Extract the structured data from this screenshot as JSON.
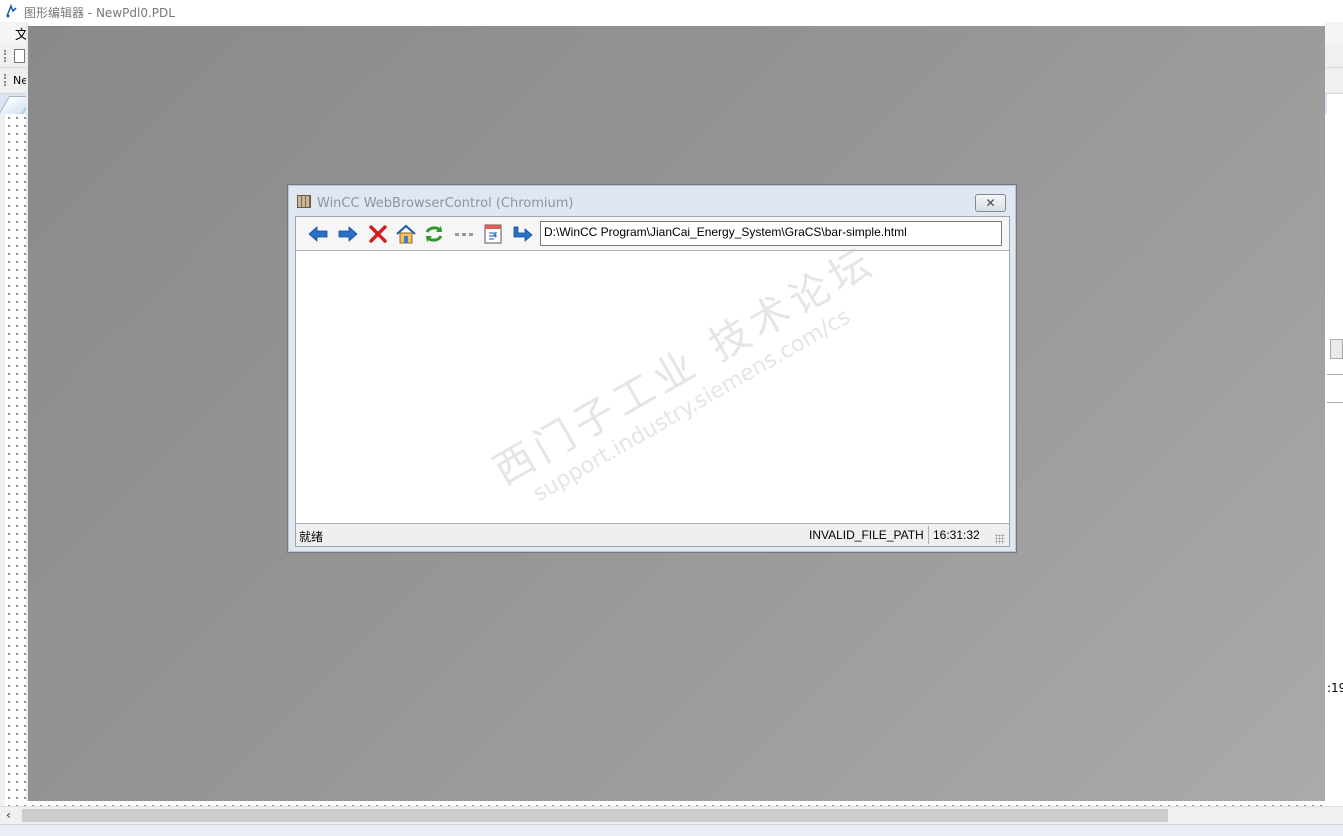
{
  "app": {
    "title": "图形编辑器 - NewPdl0.PDL",
    "menu_first": "文",
    "toolbar_label": "Ne"
  },
  "right_edge": {
    "cut_text": ":19"
  },
  "dialog": {
    "title": "WinCC WebBrowserControl (Chromium)",
    "close_glyph": "✕",
    "nav_icons": [
      "back-arrow-icon",
      "forward-arrow-icon",
      "stop-x-icon",
      "home-icon",
      "refresh-icon",
      "more-dots-icon",
      "bookmark-page-icon",
      "go-arrow-icon"
    ],
    "url": "D:\\WinCC Program\\JianCai_Energy_System\\GraCS\\bar-simple.html",
    "status_left": "就绪",
    "status_path": "INVALID_FILE_PATH",
    "status_time": "16:31:32",
    "watermark_cn": "西门子工业 技术论坛",
    "watermark_en": "support.industry.siemens.com/cs"
  },
  "colors": {
    "nav_blue": "#2a6fc9",
    "stop_red": "#d41c1c",
    "refresh_green": "#2d9a2d"
  }
}
